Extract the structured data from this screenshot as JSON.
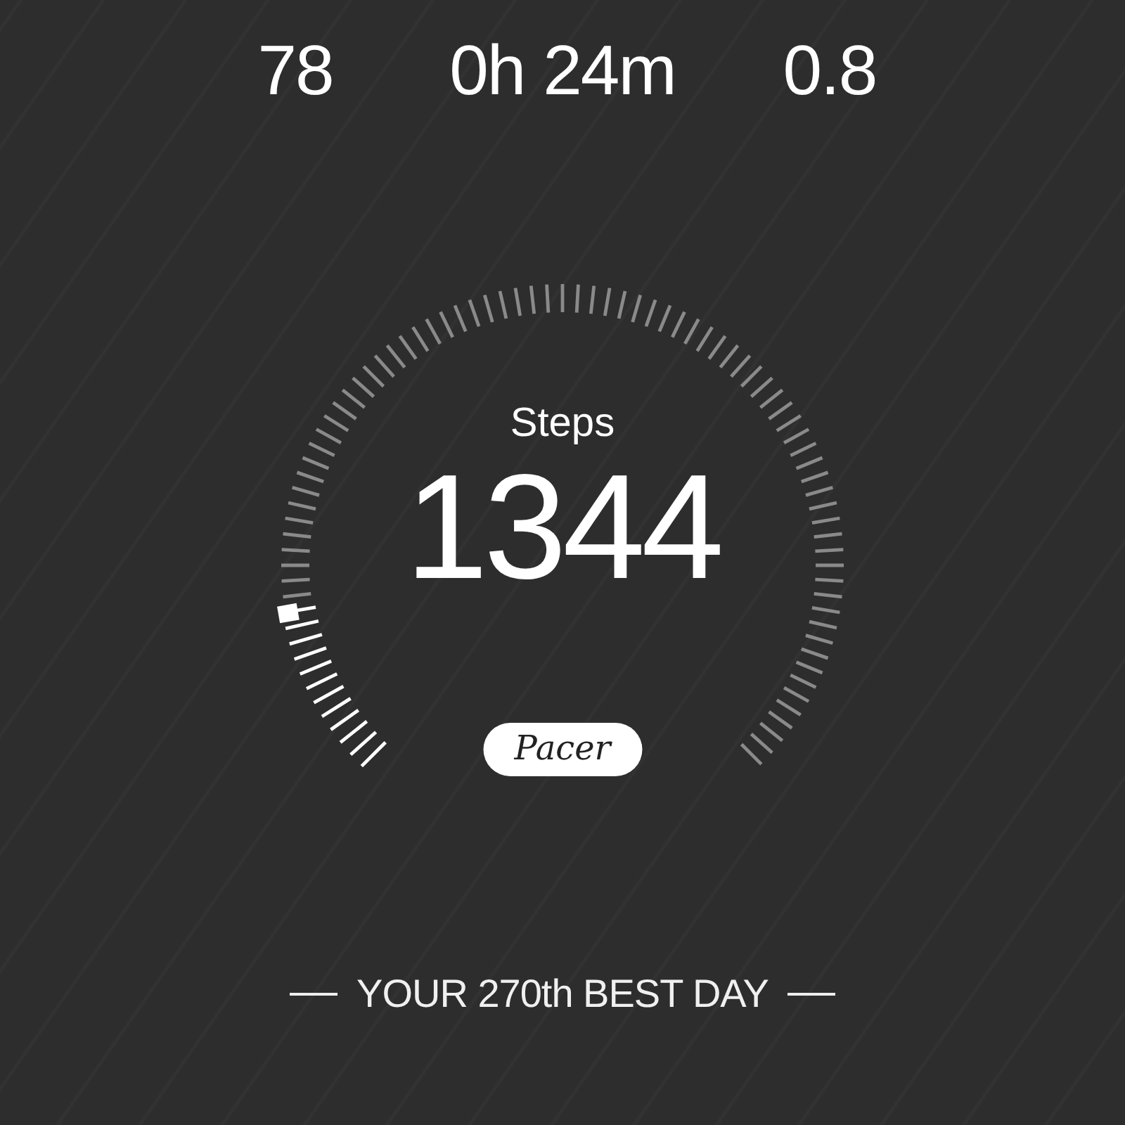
{
  "stats": [
    {
      "value": "78"
    },
    {
      "value": "0h 24m"
    },
    {
      "value": "0.8"
    }
  ],
  "steps": {
    "label": "Steps",
    "value": "1344"
  },
  "logo": "Pacer",
  "rank": "YOUR 270th BEST DAY"
}
